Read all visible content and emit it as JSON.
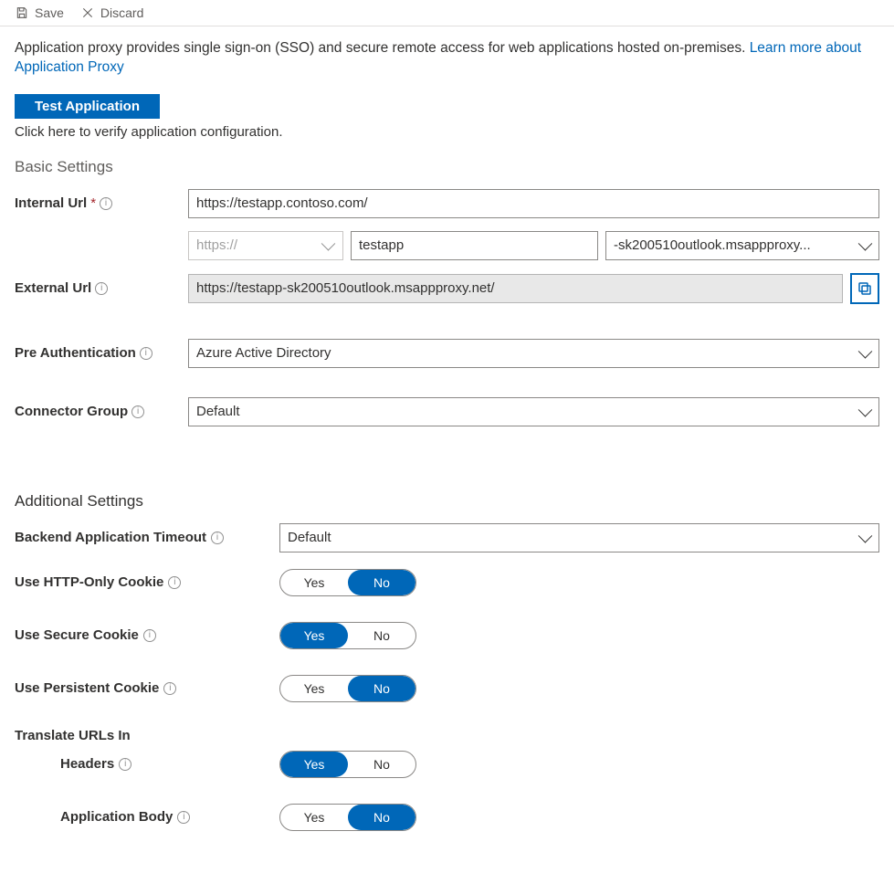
{
  "toolbar": {
    "save_label": "Save",
    "discard_label": "Discard"
  },
  "intro": {
    "text": "Application proxy provides single sign-on (SSO) and secure remote access for web applications hosted on-premises. ",
    "link": "Learn more about Application Proxy"
  },
  "test": {
    "button_label": "Test Application",
    "verify_text": "Click here to verify application configuration."
  },
  "section_basic": "Basic Settings",
  "basic": {
    "internal_url_label": "Internal Url",
    "internal_url_value": "https://testapp.contoso.com/",
    "external_url_label": "External Url",
    "protocol_value": "https://",
    "subdomain_value": "testapp",
    "domain_value": "-sk200510outlook.msappproxy...",
    "external_url_value": "https://testapp-sk200510outlook.msappproxy.net/",
    "preauth_label": "Pre Authentication",
    "preauth_value": "Azure Active Directory",
    "connector_label": "Connector Group",
    "connector_value": "Default"
  },
  "section_additional": "Additional Settings",
  "additional": {
    "timeout_label": "Backend Application Timeout",
    "timeout_value": "Default",
    "http_only_label": "Use HTTP-Only Cookie",
    "secure_cookie_label": "Use Secure Cookie",
    "persistent_cookie_label": "Use Persistent Cookie",
    "translate_title": "Translate URLs In",
    "headers_label": "Headers",
    "body_label": "Application Body"
  },
  "toggle": {
    "yes": "Yes",
    "no": "No"
  },
  "toggle_states": {
    "http_only": "No",
    "secure": "Yes",
    "persistent": "No",
    "headers": "Yes",
    "body": "No"
  }
}
